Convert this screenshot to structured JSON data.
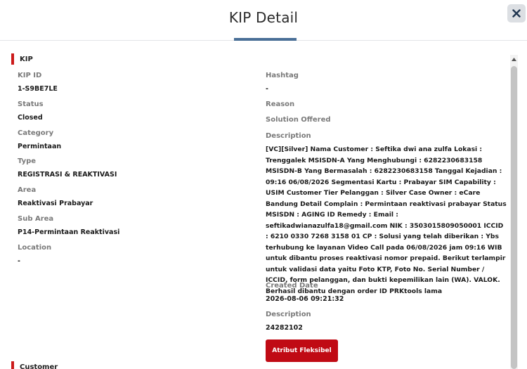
{
  "modal": {
    "title": "KIP Detail",
    "close_icon": "close-icon"
  },
  "sections": {
    "kip": "KIP",
    "customer": "Customer"
  },
  "left_fields": [
    {
      "label": "KIP ID",
      "value": "1-S9BE7LE"
    },
    {
      "label": "Status",
      "value": "Closed"
    },
    {
      "label": "Category",
      "value": "Permintaan"
    },
    {
      "label": "Type",
      "value": "REGISTRASI & REAKTIVASI"
    },
    {
      "label": "Area",
      "value": "Reaktivasi Prabayar"
    },
    {
      "label": "Sub Area",
      "value": "P14-Permintaan Reaktivasi"
    },
    {
      "label": "Location",
      "value": "-"
    }
  ],
  "right_fields": {
    "hashtag": {
      "label": "Hashtag",
      "value": "-"
    },
    "reason": {
      "label": "Reason"
    },
    "solution": {
      "label": "Solution Offered"
    },
    "description": {
      "label": "Description",
      "value": "[VC][Silver] Nama Customer : Seftika dwi ana zulfa Lokasi : Trenggalek MSISDN-A Yang Menghubungi : 6282230683158 MSISDN-B Yang Bermasalah : 6282230683158 Tanggal Kejadian : 09:16 06/08/2026 Segmentasi Kartu : Prabayar SIM Capability : USIM Customer Tier Pelanggan : Silver Case Owner : eCare Bandung Detail Complain : Permintaan reaktivasi prabayar Status MSISDN : AGING ID Remedy : Email : seftikadwianazulfa18@gmail.com NIK : 3503015809050001 ICCID : 6210 0330 7268 3158 01 CP : Solusi yang telah diberikan : Ybs terhubung ke layanan Video Call pada 06/08/2026 jam 09:16 WIB untuk dibantu proses reaktivasi nomor prepaid. Berikut terlampir untuk validasi data yaitu Foto KTP, Foto No. Serial Number / ICCID, form pelanggan, dan bukti kepemilikan lain (WA). VALOK. Berhasil dibantu dengan order ID PRKtools lama"
    },
    "created_date": {
      "label": "Created Date",
      "value": "2026-08-06 09:21:32"
    },
    "description2": {
      "label": "Description",
      "value": "24282102"
    }
  },
  "buttons": {
    "atribut_fleksibel": "Atribut Fleksibel"
  },
  "colors": {
    "accent_red": "#cc1a1a",
    "button_red": "#c00a14",
    "title_underline": "#4a6f97"
  }
}
